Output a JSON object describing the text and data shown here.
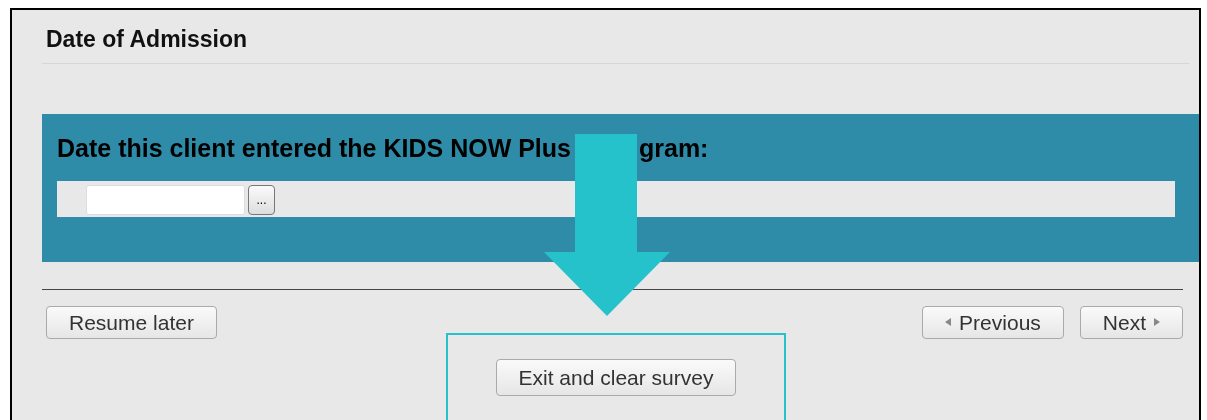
{
  "section": {
    "title": "Date of Admission"
  },
  "question": {
    "text_before_arrow": "Date this client entered the KIDS NOW Plus",
    "text_after_arrow": "gram:",
    "picker_button": "..."
  },
  "navigation": {
    "resume": "Resume later",
    "previous": "Previous",
    "next": "Next"
  },
  "highlight": {
    "button": "Exit and clear survey"
  }
}
